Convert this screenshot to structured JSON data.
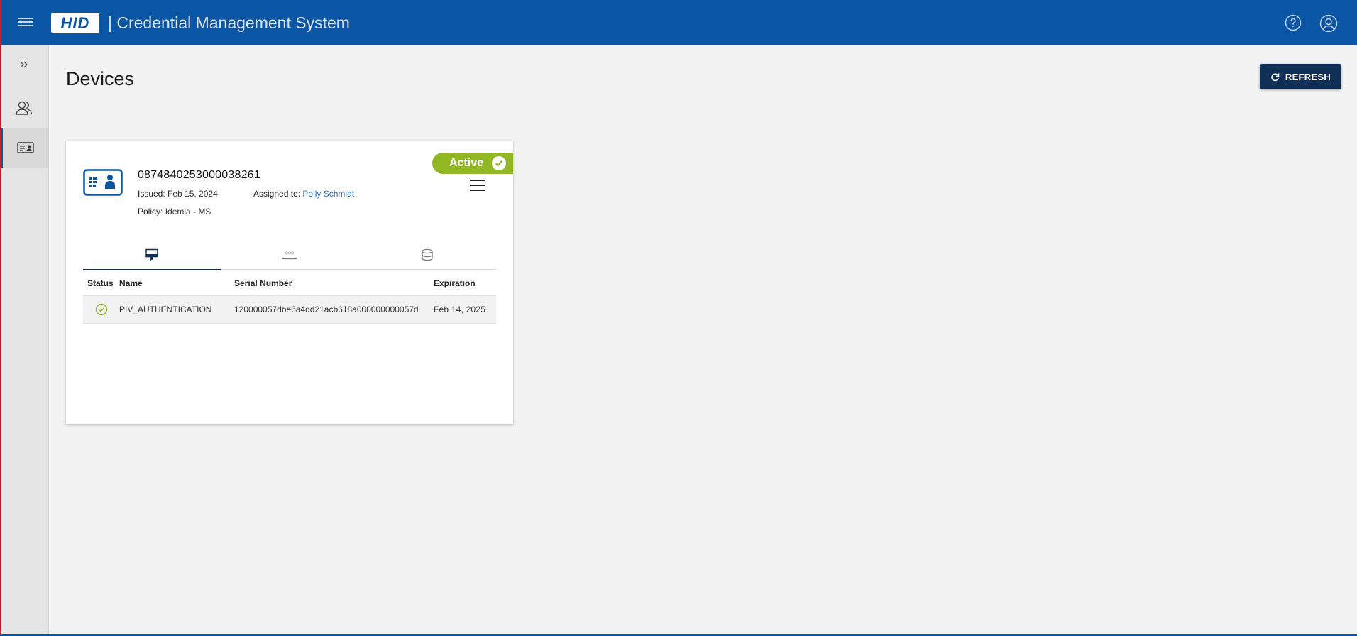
{
  "header": {
    "logo_text": "HID",
    "app_title": "| Credential Management System",
    "brand_color": "#0b56a4",
    "icons": [
      "menu-icon",
      "help-icon",
      "user-account-icon"
    ]
  },
  "sidebar": {
    "items": [
      {
        "icon": "expand-chevrons-icon"
      },
      {
        "icon": "users-icon"
      },
      {
        "icon": "id-card-icon",
        "active": true
      }
    ]
  },
  "page": {
    "title": "Devices",
    "refresh_label": "REFRESH"
  },
  "device": {
    "status": "Active",
    "status_color": "#92b725",
    "id": "0874840253000038261",
    "issued_label": "Issued:",
    "issued_value": "Feb 15, 2024",
    "assigned_label": "Assigned to:",
    "assigned_value": "Polly Schmidt",
    "policy_label": "Policy:",
    "policy_value": "Idemia - MS",
    "tabs": [
      {
        "icon": "certificate-icon",
        "active": true
      },
      {
        "icon": "password-icon"
      },
      {
        "icon": "storage-icon"
      }
    ]
  },
  "table": {
    "headers": [
      "Status",
      "Name",
      "Serial Number",
      "Expiration"
    ],
    "rows": [
      {
        "status": "valid",
        "name": "PIV_AUTHENTICATION",
        "serial": "120000057dbe6a4dd21acb618a000000000057d",
        "expiration": "Feb 14, 2025"
      }
    ]
  }
}
